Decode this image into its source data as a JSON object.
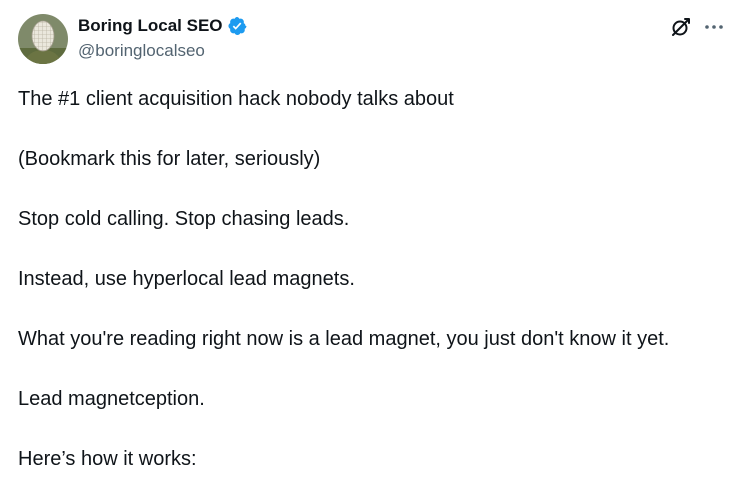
{
  "author": {
    "display_name": "Boring Local SEO",
    "handle": "@boringlocalseo",
    "verified": true
  },
  "actions": {
    "grok_icon": "grok-icon",
    "more_icon": "more-options-icon"
  },
  "tweet": {
    "paragraphs": [
      "The #1 client acquisition hack nobody talks about",
      "(Bookmark this for later, seriously)",
      "Stop cold calling. Stop chasing leads.",
      "Instead, use hyperlocal lead magnets.",
      "What you're reading right now is a lead magnet, you just don't know it yet.",
      "Lead magnetception.",
      "Here’s how it works:"
    ]
  },
  "colors": {
    "text": "#0f1419",
    "secondary": "#536471",
    "verified_blue": "#1d9bf0"
  }
}
